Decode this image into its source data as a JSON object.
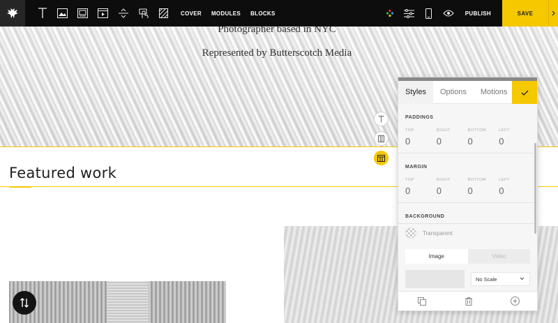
{
  "toolbar": {
    "icons": [
      "logo-bird-icon",
      "text-icon",
      "image-icon",
      "gallery-icon",
      "video-icon",
      "divider-icon",
      "button-icon",
      "pattern-icon"
    ],
    "nav": [
      "COVER",
      "MODULES",
      "BLOCKS"
    ],
    "right_icons": [
      "color-palette-icon",
      "sliders-icon",
      "mobile-icon",
      "eye-icon"
    ],
    "publish_label": "PUBLISH",
    "save_label": "SAVE"
  },
  "hero": {
    "line1": "Photographer based in NYC",
    "line2": "Represented by Butterscotch Media"
  },
  "featured": {
    "title": "Featured work"
  },
  "panel": {
    "tabs": [
      "Styles",
      "Options",
      "Motions"
    ],
    "active_tab": "Styles",
    "paddings": {
      "title": "PADDINGS",
      "labels": [
        "TOP",
        "RIGHT",
        "BOTTOM",
        "LEFT"
      ],
      "values": [
        "0",
        "0",
        "0",
        "0"
      ]
    },
    "margin": {
      "title": "MARGIN",
      "labels": [
        "TOP",
        "RIGHT",
        "BOTTOM",
        "LEFT"
      ],
      "values": [
        "0",
        "0",
        "0",
        "0"
      ]
    },
    "background": {
      "title": "BACKGROUND",
      "value": "Transparent",
      "media_options": [
        "Image",
        "Video"
      ],
      "media_selected": "Image",
      "scale": "No Scale"
    }
  },
  "colors": {
    "accent": "#f5c800",
    "toolbar_bg": "#0d0d0d"
  }
}
